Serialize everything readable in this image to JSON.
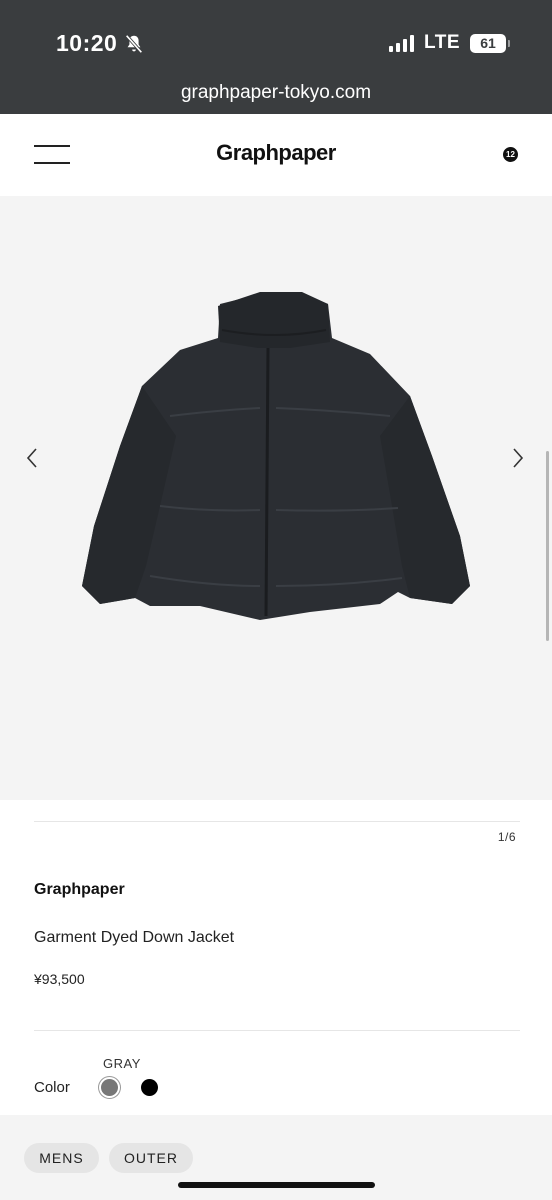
{
  "status_bar": {
    "time": "10:20",
    "network": "LTE",
    "battery": "61",
    "icons": [
      "bell-slash-icon",
      "signal-icon",
      "battery-icon"
    ]
  },
  "browser": {
    "url": "graphpaper-tokyo.com"
  },
  "header": {
    "logo": "Graphpaper",
    "cart_count": "12",
    "icons": [
      "hamburger-menu-icon"
    ]
  },
  "gallery": {
    "counter": "1/6",
    "icons": [
      "chevron-left-icon",
      "chevron-right-icon"
    ]
  },
  "product": {
    "brand": "Graphpaper",
    "name": "Garment Dyed Down Jacket",
    "price": "¥93,500",
    "color_label": "Color",
    "selected_color": "GRAY",
    "swatches": [
      {
        "name": "GRAY",
        "hex": "#777777"
      },
      {
        "name": "BLACK",
        "hex": "#000000"
      }
    ]
  },
  "tags": [
    "MENS",
    "OUTER"
  ],
  "colors": {
    "status_bar_bg": "#3a3d3f",
    "gallery_bg": "#f4f4f4",
    "tag_bg": "#e5e5e5"
  }
}
